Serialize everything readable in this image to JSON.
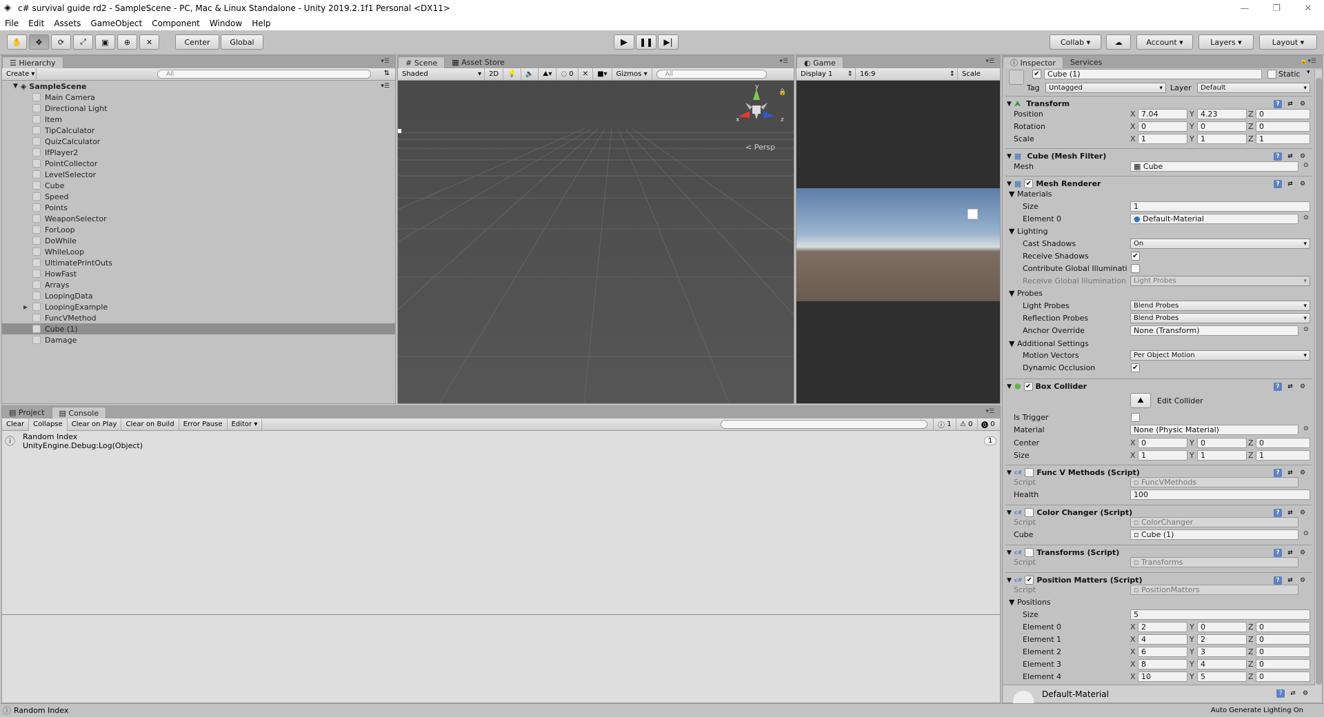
{
  "window": {
    "title": "c# survival guide rd2 - SampleScene - PC, Mac & Linux Standalone - Unity 2019.2.1f1 Personal <DX11>"
  },
  "menu": [
    "File",
    "Edit",
    "Assets",
    "GameObject",
    "Component",
    "Window",
    "Help"
  ],
  "toolbar": {
    "center": "Center",
    "global": "Global",
    "collab": "Collab",
    "account": "Account",
    "layers": "Layers",
    "layout": "Layout"
  },
  "hierarchy": {
    "tab": "Hierarchy",
    "create": "Create",
    "search": "All",
    "scene": "SampleScene",
    "items": [
      "Main Camera",
      "Directional Light",
      "Item",
      "TipCalculator",
      "QuizCalculator",
      "IfPlayer2",
      "PointCollector",
      "LevelSelector",
      "Cube",
      "Speed",
      "Points",
      "WeaponSelector",
      "ForLoop",
      "DoWhile",
      "WhileLoop",
      "UltimatePrintOuts",
      "HowFast",
      "Arrays",
      "LoopingData",
      "LoopingExample",
      "FuncVMethod",
      "Cube (1)",
      "Damage"
    ]
  },
  "scene": {
    "tab": "Scene",
    "asset_store": "Asset Store",
    "shaded": "Shaded",
    "two_d": "2D",
    "fx_count": "0",
    "gizmos": "Gizmos",
    "search": "All",
    "persp": "Persp",
    "axis_y": "y",
    "axis_x": "x",
    "axis_z": "z"
  },
  "game": {
    "tab": "Game",
    "display": "Display 1",
    "aspect": "16:9",
    "scale": "Scale"
  },
  "inspector": {
    "tab": "Inspector",
    "services": "Services",
    "object_name": "Cube (1)",
    "static": "Static",
    "tag_label": "Tag",
    "tag": "Untagged",
    "layer_label": "Layer",
    "layer": "Default",
    "transform": {
      "title": "Transform",
      "position": {
        "label": "Position",
        "x": "7.04",
        "y": "4.23",
        "z": "0"
      },
      "rotation": {
        "label": "Rotation",
        "x": "0",
        "y": "0",
        "z": "0"
      },
      "scale": {
        "label": "Scale",
        "x": "1",
        "y": "1",
        "z": "1"
      }
    },
    "mesh_filter": {
      "title": "Cube (Mesh Filter)",
      "mesh_label": "Mesh",
      "mesh": "Cube"
    },
    "mesh_renderer": {
      "title": "Mesh Renderer",
      "materials": "Materials",
      "size_label": "Size",
      "size": "1",
      "element0_label": "Element 0",
      "element0": "Default-Material",
      "lighting": "Lighting",
      "cast_shadows_label": "Cast Shadows",
      "cast_shadows": "On",
      "receive_shadows_label": "Receive Shadows",
      "contribute_gi_label": "Contribute Global Illuminati",
      "receive_gi_label": "Receive Global Illumination",
      "receive_gi": "Light Probes",
      "probes": "Probes",
      "light_probes_label": "Light Probes",
      "light_probes": "Blend Probes",
      "reflection_probes_label": "Reflection Probes",
      "reflection_probes": "Blend Probes",
      "anchor_override_label": "Anchor Override",
      "anchor_override": "None (Transform)",
      "additional": "Additional Settings",
      "motion_vectors_label": "Motion Vectors",
      "motion_vectors": "Per Object Motion",
      "dynamic_occlusion_label": "Dynamic Occlusion"
    },
    "box_collider": {
      "title": "Box Collider",
      "edit_collider": "Edit Collider",
      "is_trigger_label": "Is Trigger",
      "material_label": "Material",
      "material": "None (Physic Material)",
      "center": {
        "label": "Center",
        "x": "0",
        "y": "0",
        "z": "0"
      },
      "size": {
        "label": "Size",
        "x": "1",
        "y": "1",
        "z": "1"
      }
    },
    "func_v": {
      "title": "Func V Methods (Script)",
      "script_label": "Script",
      "script": "FuncVMethods",
      "health_label": "Health",
      "health": "100"
    },
    "color_changer": {
      "title": "Color Changer (Script)",
      "script_label": "Script",
      "script": "ColorChanger",
      "cube_label": "Cube",
      "cube": "Cube (1)"
    },
    "transforms": {
      "title": "Transforms (Script)",
      "script_label": "Script",
      "script": "Transforms"
    },
    "position_matters": {
      "title": "Position Matters (Script)",
      "script_label": "Script",
      "script": "PositionMatters",
      "positions_label": "Positions",
      "size_label": "Size",
      "size": "5",
      "elements": [
        {
          "label": "Element 0",
          "x": "2",
          "y": "0",
          "z": "0"
        },
        {
          "label": "Element 1",
          "x": "4",
          "y": "2",
          "z": "0"
        },
        {
          "label": "Element 2",
          "x": "6",
          "y": "3",
          "z": "0"
        },
        {
          "label": "Element 3",
          "x": "8",
          "y": "4",
          "z": "0"
        },
        {
          "label": "Element 4",
          "x": "10",
          "y": "5",
          "z": "0"
        }
      ]
    },
    "material_footer": "Default-Material",
    "axis_labels": {
      "x": "X",
      "y": "Y",
      "z": "Z"
    }
  },
  "console": {
    "project_tab": "Project",
    "console_tab": "Console",
    "buttons": [
      "Clear",
      "Collapse",
      "Clear on Play",
      "Clear on Build",
      "Error Pause",
      "Editor"
    ],
    "count_info": "1",
    "count_warn": "0",
    "count_error": "0",
    "log_line1": "Random Index",
    "log_line2": "UnityEngine.Debug:Log(Object)",
    "log_count": "1"
  },
  "status": {
    "message": "Random Index",
    "right": "Auto Generate Lighting On"
  }
}
